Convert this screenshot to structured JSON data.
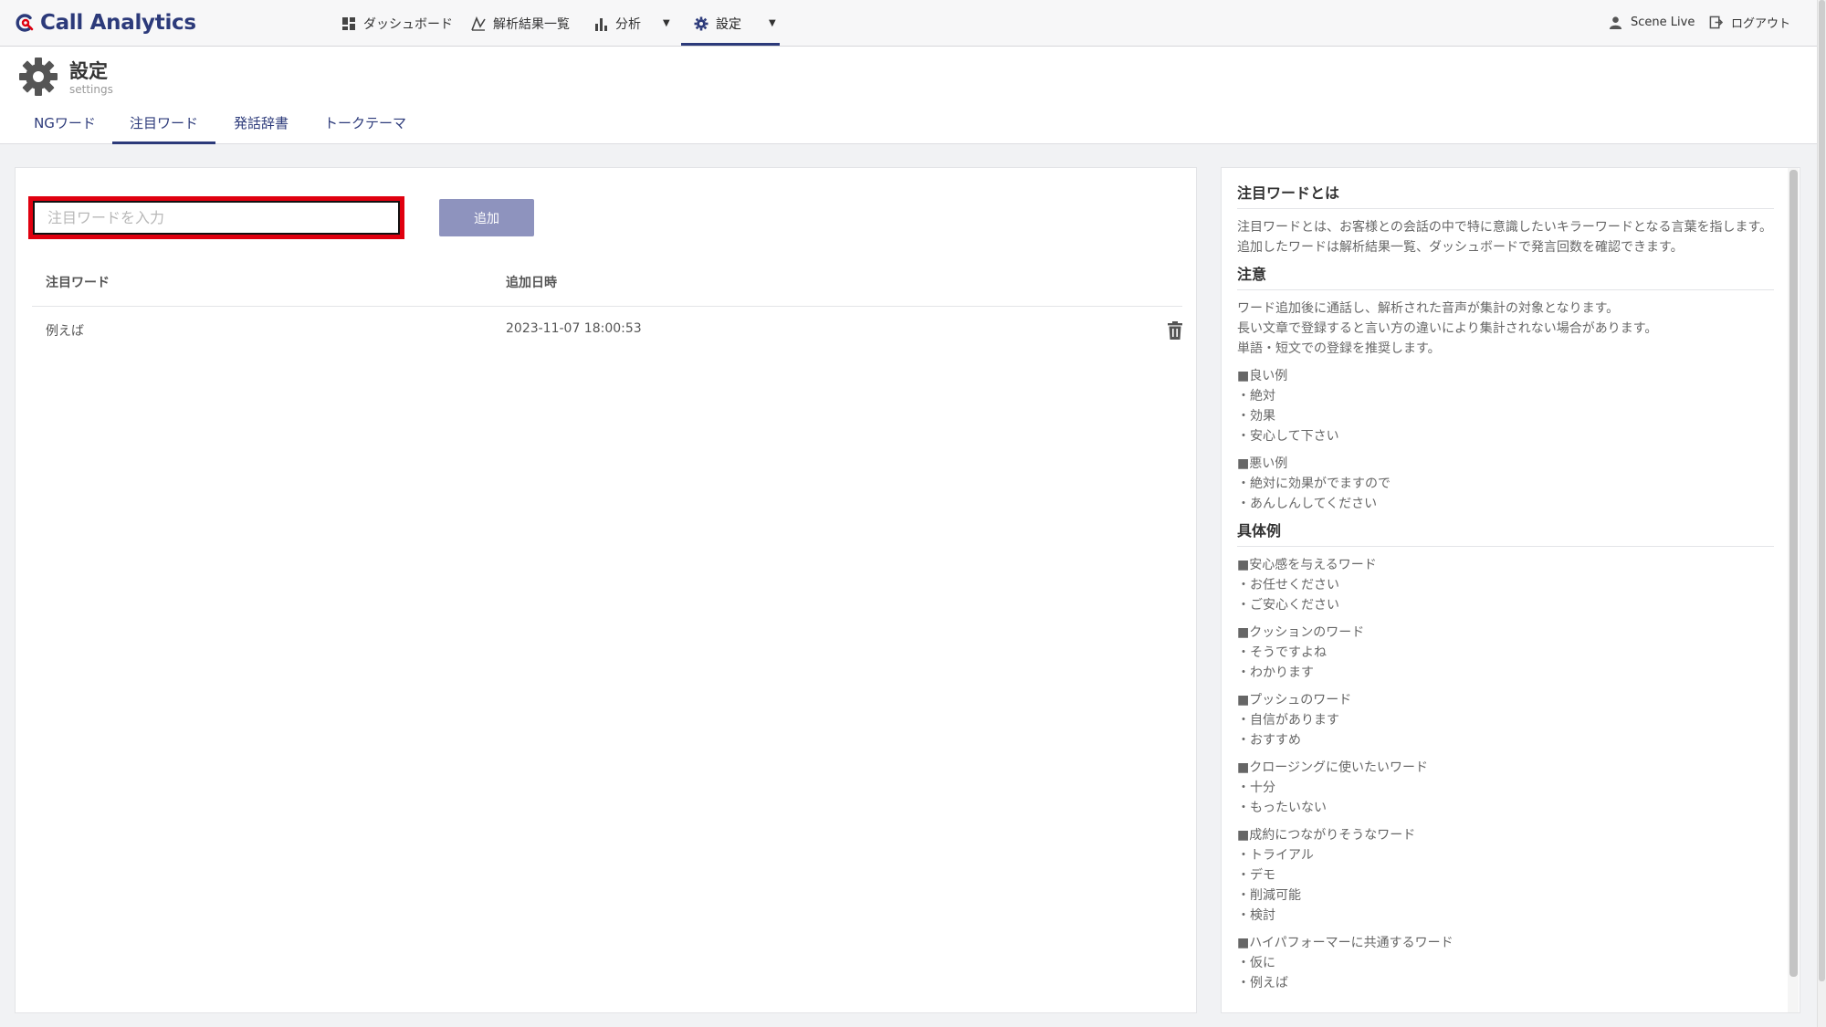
{
  "app": {
    "name": "Call Analytics"
  },
  "nav": {
    "items": [
      {
        "label": "ダッシュボード",
        "icon": "dashboard-icon"
      },
      {
        "label": "解析結果一覧",
        "icon": "chart-line-icon"
      },
      {
        "label": "分析",
        "icon": "bar-chart-icon",
        "has_dropdown": true
      },
      {
        "label": "設定",
        "icon": "gear-icon",
        "has_dropdown": true,
        "active": true
      }
    ]
  },
  "user": {
    "name": "Scene Live",
    "logout_label": "ログアウト"
  },
  "page": {
    "title": "設定",
    "subtitle": "settings"
  },
  "tabs": [
    {
      "label": "NGワード",
      "active": false
    },
    {
      "label": "注目ワード",
      "active": true
    },
    {
      "label": "発話辞書",
      "active": false
    },
    {
      "label": "トークテーマ",
      "active": false
    }
  ],
  "form": {
    "input_placeholder": "注目ワードを入力",
    "input_value": "",
    "add_label": "追加"
  },
  "table": {
    "headers": [
      "注目ワード",
      "追加日時"
    ],
    "rows": [
      {
        "word": "例えば",
        "added_at": "2023-11-07 18:00:53"
      }
    ]
  },
  "help": {
    "about_title": "注目ワードとは",
    "about_lines": [
      "注目ワードとは、お客様との会話の中で特に意識したいキラーワードとなる言葉を指します。",
      "追加したワードは解析結果一覧、ダッシュボードで発言回数を確認できます。"
    ],
    "caution_title": "注意",
    "caution_lines": [
      "ワード追加後に通話し、解析された音声が集計の対象となります。",
      "長い文章で登録すると言い方の違いにより集計されない場合があります。",
      "単語・短文での登録を推奨します。"
    ],
    "caution_examples": [
      {
        "heading": "■良い例",
        "items": [
          "・絶対",
          "・効果",
          "・安心して下さい"
        ]
      },
      {
        "heading": "■悪い例",
        "items": [
          "・絶対に効果がでますので",
          "・あんしんしてください"
        ]
      }
    ],
    "examples_title": "具体例",
    "examples": [
      {
        "heading": "■安心感を与えるワード",
        "items": [
          "・お任せください",
          "・ご安心ください"
        ]
      },
      {
        "heading": "■クッションのワード",
        "items": [
          "・そうですよね",
          "・わかります"
        ]
      },
      {
        "heading": "■プッシュのワード",
        "items": [
          "・自信があります",
          "・おすすめ"
        ]
      },
      {
        "heading": "■クロージングに使いたいワード",
        "items": [
          "・十分",
          "・もったいない"
        ]
      },
      {
        "heading": "■成約につながりそうなワード",
        "items": [
          "・トライアル",
          "・デモ",
          "・削減可能",
          "・検討"
        ]
      },
      {
        "heading": "■ハイパフォーマーに共通するワード",
        "items": [
          "・仮に",
          "・例えば"
        ]
      }
    ]
  },
  "colors": {
    "brand": "#2c3a7a",
    "accent_red": "#e0000f",
    "button": "#8e93be"
  }
}
